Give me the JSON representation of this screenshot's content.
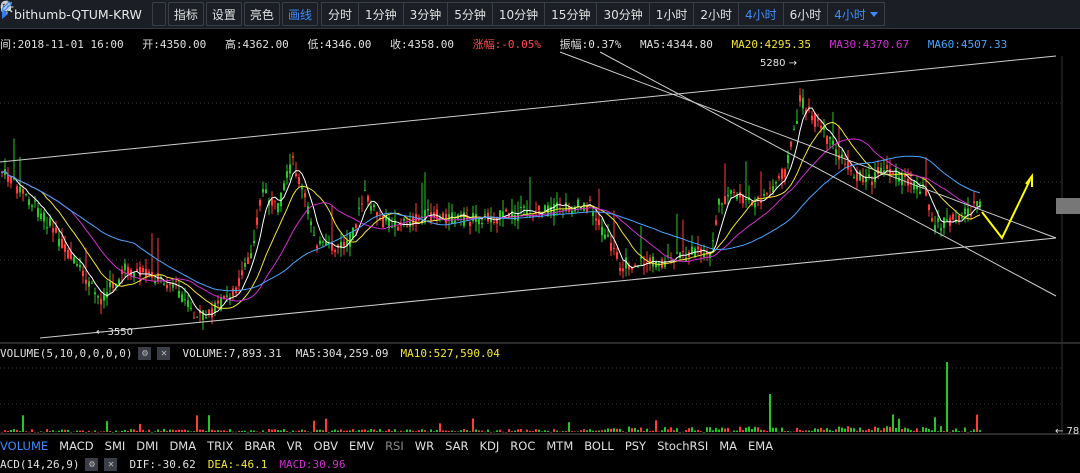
{
  "toolbar": {
    "symbol": "bithumb-QTUM-KRW",
    "indicator_label": "指标",
    "settings_label": "设置",
    "theme_label": "亮色",
    "draw_label": "画线",
    "periods": [
      "分时",
      "1分钟",
      "3分钟",
      "5分钟",
      "10分钟",
      "15分钟",
      "30分钟",
      "1小时",
      "2小时",
      "4小时",
      "6小时",
      "4小时"
    ],
    "active_period_index": 9
  },
  "ohlc": {
    "time": "间:2018-11-01 16:00",
    "open": "开:4350.00",
    "high": "高:4362.00",
    "low": "低:4346.00",
    "close": "收:4358.00",
    "change": "涨幅:-0.05%",
    "amplitude": "振幅:0.37%",
    "ma5": "MA5:4344.80",
    "ma20": "MA20:4295.35",
    "ma30": "MA30:4370.67",
    "ma60": "MA60:4507.33"
  },
  "price_annotations": {
    "high_label": "5280 →",
    "low_label": "← 3550"
  },
  "volume": {
    "title": "VOLUME(5,10,0,0,0,0)",
    "volume": "VOLUME:7,893.31",
    "ma5": "MA5:304,259.09",
    "ma10": "MA10:527,590.04",
    "right_label": "← 78"
  },
  "indicators": [
    "VOLUME",
    "MACD",
    "SMI",
    "DMI",
    "DMA",
    "TRIX",
    "BRAR",
    "VR",
    "OBV",
    "EMV",
    "RSI",
    "WR",
    "SAR",
    "KDJ",
    "ROC",
    "MTM",
    "BOLL",
    "PSY",
    "StochRSI",
    "MA",
    "EMA"
  ],
  "active_indicator": "VOLUME",
  "macd": {
    "title": "ACD(14,26,9)",
    "dif": "DIF:-30.62",
    "dea": "DEA:-46.1",
    "macd": "MACD:30.96"
  },
  "colors": {
    "up": "#26c626",
    "down": "#ff3b3b",
    "ma5": "#ffffff",
    "ma20": "#f5e63a",
    "ma30": "#d12fd1",
    "ma60": "#4ba3ff",
    "accent": "#3d8bff",
    "arrow": "#ffff00"
  }
}
